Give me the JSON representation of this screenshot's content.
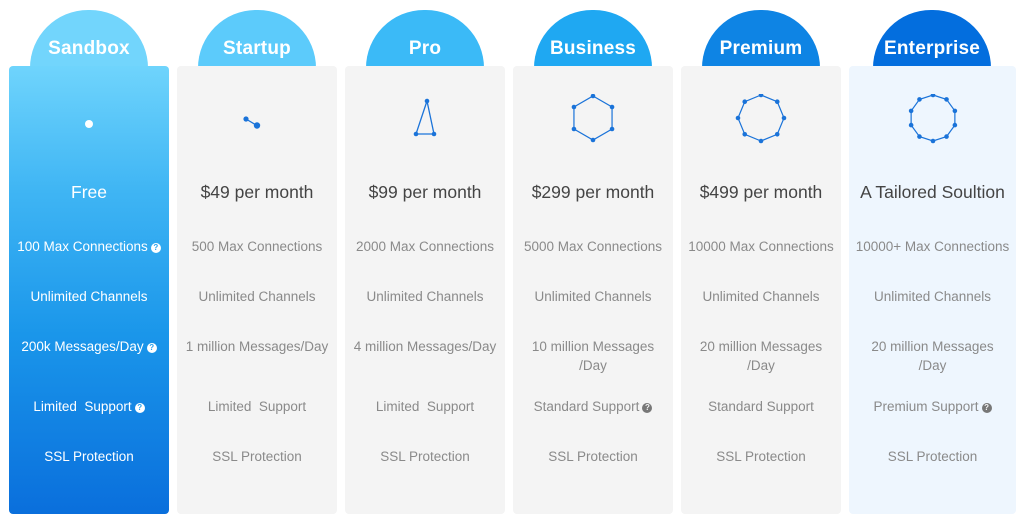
{
  "question_icon_glyph": "?",
  "plans": [
    {
      "name": "Sandbox",
      "tab_color": "#72d5fc",
      "icon": "single-node-icon",
      "price": "Free",
      "features": {
        "connections": "100 Max Connections",
        "channels": "Unlimited Channels",
        "messages": "200k Messages/Day",
        "support": "Limited  Support",
        "ssl": "SSL Protection"
      }
    },
    {
      "name": "Startup",
      "tab_color": "#5ccbfb",
      "icon": "two-node-icon",
      "price": "$49 per month",
      "features": {
        "connections": "500 Max Connections",
        "channels": "Unlimited Channels",
        "messages": "1 million Messages/Day",
        "support": "Limited  Support",
        "ssl": "SSL Protection"
      }
    },
    {
      "name": "Pro",
      "tab_color": "#3bbaf7",
      "icon": "triangle-network-icon",
      "price": "$99 per month",
      "features": {
        "connections": "2000 Max Connections",
        "channels": "Unlimited Channels",
        "messages": "4 million Messages/Day",
        "support": "Limited  Support",
        "ssl": "SSL Protection"
      }
    },
    {
      "name": "Business",
      "tab_color": "#1fa8f2",
      "icon": "hexagon-network-icon",
      "price": "$299 per month",
      "features": {
        "connections": "5000 Max Connections",
        "channels": "Unlimited Channels",
        "messages_line1": "10 million Messages",
        "messages_line2": "/Day",
        "support": "Standard Support",
        "ssl": "SSL Protection"
      }
    },
    {
      "name": "Premium",
      "tab_color": "#0e84e4",
      "icon": "octagon-network-icon",
      "price": "$499 per month",
      "features": {
        "connections": "10000 Max Connections",
        "channels": "Unlimited Channels",
        "messages_line1": "20 million Messages",
        "messages_line2": "/Day",
        "support": "Standard Support",
        "ssl": "SSL Protection"
      }
    },
    {
      "name": "Enterprise",
      "tab_color": "#036ede",
      "icon": "decagon-network-icon",
      "price": "A Tailored Soultion",
      "features": {
        "connections": "10000+ Max Connections",
        "channels": "Unlimited Channels",
        "messages_line1": "20 million Messages",
        "messages_line2": "/Day",
        "support": "Premium Support",
        "ssl": "SSL Protection"
      }
    }
  ]
}
